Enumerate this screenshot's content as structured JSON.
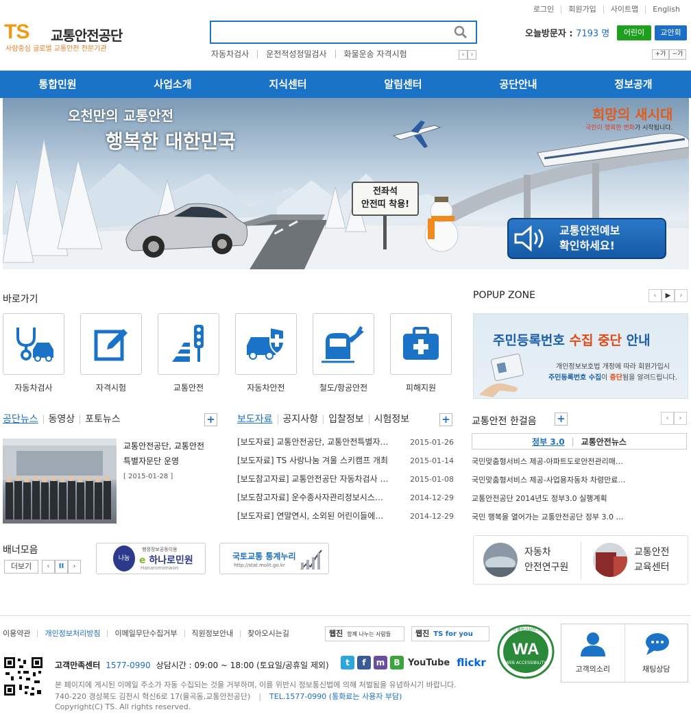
{
  "util": {
    "login": "로그인",
    "join": "회원가입",
    "sitemap": "사이트맵",
    "english": "English"
  },
  "logo": {
    "mark": "TS",
    "name": "교통안전공단",
    "slogan": "사람중심 글로벌 교통안전 전문기관"
  },
  "search": {
    "value": "",
    "placeholder": ""
  },
  "quick": [
    "자동차검사",
    "운전적성정밀검사",
    "화물운송 자격시험"
  ],
  "visitor": {
    "label": "오늘방문자 : ",
    "count": "7193 명"
  },
  "buttons": {
    "kids": "어린이",
    "teacher": "교안회"
  },
  "fontsize": {
    "up": "+가",
    "down": "−가"
  },
  "nav": [
    "통합민원",
    "사업소개",
    "지식센터",
    "알림센터",
    "공단안내",
    "정보공개"
  ],
  "banner": {
    "slogan1": "오천만의 교통안전",
    "slogan2": "행복한 대한민국",
    "hope": "희망의 새시대",
    "hope_sub_1": "국민이 ",
    "hope_sub_2": "행복한 변화",
    "hope_sub_3": "가 시작됩니다.",
    "sign1": "전좌석",
    "sign2": "안전띠 착용!",
    "alert1": "교통안전예보",
    "alert2": "확인하세요!"
  },
  "shortcuts": {
    "title": "바로가기",
    "items": [
      "자동차검사",
      "자격시험",
      "교통안전",
      "자동차안전",
      "철도/항공안전",
      "피해지원"
    ]
  },
  "popup": {
    "title": "POPUP ZONE",
    "heading_1": "주민등록번호 ",
    "heading_2": "수집 중단",
    "heading_3": " 안내",
    "line1": "개인정보보호법 개정에 따라 회원가입시",
    "line2_1": "주민등록번호 수집",
    "line2_2": "이 ",
    "line2_3": "중단",
    "line2_4": "됨을 알려드립니다."
  },
  "news_tabs": [
    "공단뉴스",
    "동영상",
    "포토뉴스"
  ],
  "news_feature": {
    "title1": "교통안전공단, 교통안전",
    "title2": "특별자문단 운영",
    "date": "[ 2015-01-28 ]"
  },
  "notice_tabs": [
    "보도자료",
    "공지사항",
    "입찰정보",
    "시험정보"
  ],
  "notices": [
    {
      "title": "[보도자료] 교통안전공단, 교통안전특별자…",
      "date": "2015-01-26"
    },
    {
      "title": "[보도자료] TS 사랑나눔 겨울 스키캠프 개최",
      "date": "2015-01-14"
    },
    {
      "title": "[보도참고자료] 교통안전공단 자동차검사 …",
      "date": "2015-01-08"
    },
    {
      "title": "[보도참고자료] 운수종사자관리정보시스…",
      "date": "2014-12-29"
    },
    {
      "title": "[보도자료] 연말연시, 소외된 어린이들에…",
      "date": "2014-12-29"
    }
  ],
  "hangeoleum": {
    "title": "교통안전 한걸음",
    "tab1": "정부 3.0",
    "tab2": "교통안전뉴스",
    "items": [
      "국민맞춤형서비스 제공-아파트도로안전관리매…",
      "국민맞춤형서비스 제공-사업용자동차 차령만료…",
      "교통안전공단 2014년도 정부3.0 실행계획",
      "국민 행복을 열어가는 교통안전공단 정부 3.0 …"
    ]
  },
  "banners": {
    "title": "배너모음",
    "more": "더보기",
    "b1_small": "행정정보공동이용",
    "b1": "하나로민원",
    "b1_logo": "나눔",
    "b1_sub": "Hanaromimwon",
    "b2": "국토교통 통계누리",
    "b2_url": "http://stat.molit.go.kr"
  },
  "research": {
    "item1_1": "자동차",
    "item1_2": "안전연구원",
    "item2_1": "교통안전",
    "item2_2": "교육센터"
  },
  "footer": {
    "links": [
      "이용약관",
      "개인정보처리방침",
      "이메일무단수집거부",
      "직원정보안내",
      "찾아오시는길"
    ],
    "badge1_b": "웹진",
    "badge1": "함께 나누는 사람들",
    "badge2_b": "웹진",
    "badge2": "TS for you",
    "wa_title": "이 웹접근성마크",
    "wa": "WA",
    "wa_sub": "WEB ACCESSIBILITY",
    "voice": "고객의소리",
    "chat": "채팅상담",
    "cs_label": "고객만족센터",
    "cs_tel": "1577-0990",
    "cs_hours": "상담시간 : 09:00 ~ 18:00 (토요일/공휴일 제외)",
    "sns_youtube": "YouTube",
    "sns_flickr": "flickr",
    "notice": "본 페이지에 게시된 이메일 주소가 자동 수집되는 것을 거부하며, 이를 위반시 정보통신법에 의해 처벌됨을 유념하시기 바랍니다.",
    "address": "740-220 경상북도 김천시 혁신6로 17(율곡동,교통안전공단)",
    "tel": "TEL.1577-0990 (통화료는 사용자 부담)",
    "copyright": "Copyright(C) TS. All rights reserved."
  }
}
